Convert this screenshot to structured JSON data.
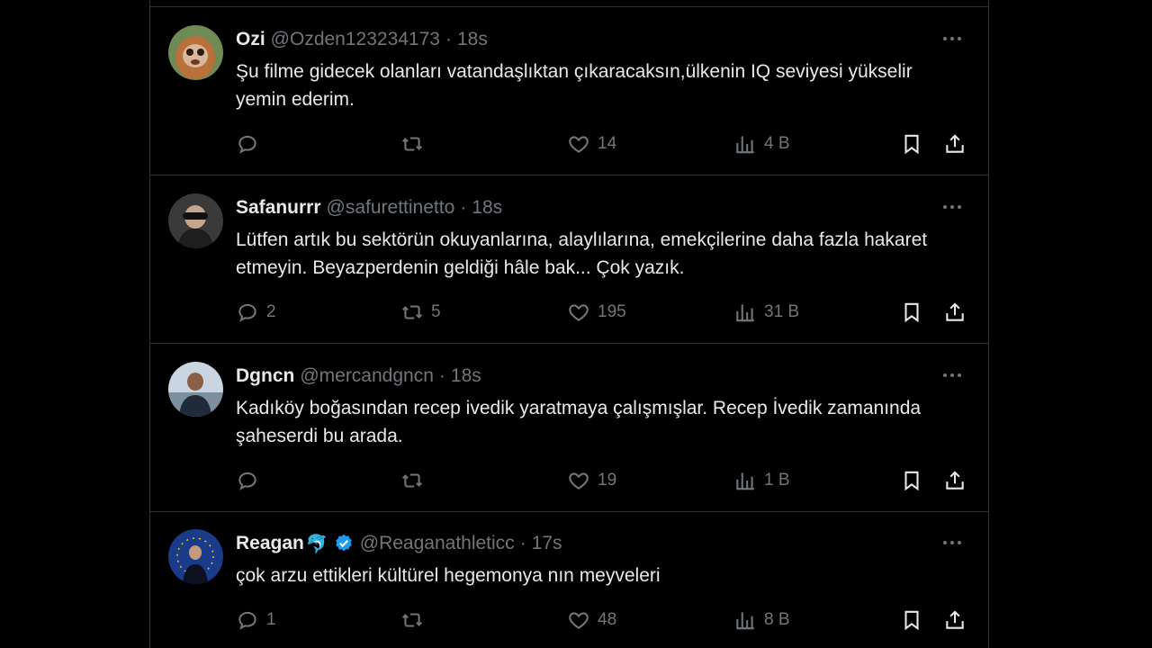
{
  "tweets": [
    {
      "name": "Ozi",
      "handle": "@Ozden123234173",
      "time": "18s",
      "text": "Şu filme gidecek olanları vatandaşlıktan çıkaracaksın,ülkenin IQ seviyesi yükselir yemin ederim.",
      "replies": "",
      "retweets": "",
      "likes": "14",
      "views": "4 B",
      "avatar_color": "#b9703a"
    },
    {
      "name": "Safanurrr",
      "handle": "@safurettinetto",
      "time": "18s",
      "text": "Lütfen artık bu sektörün okuyanlarına, alaylılarına, emekçilerine daha fazla hakaret etmeyin. Beyazperdenin geldiği hâle bak... Çok yazık.",
      "replies": "2",
      "retweets": "5",
      "likes": "195",
      "views": "31 B",
      "avatar_color": "#4a4a4a"
    },
    {
      "name": "Dgncn",
      "handle": "@mercandgncn",
      "time": "18s",
      "text": "Kadıköy boğasından recep ivedik yaratmaya çalışmışlar. Recep İvedik zamanında şaheserdi bu arada.",
      "replies": "",
      "retweets": "",
      "likes": "19",
      "views": "1 B",
      "avatar_color": "#8aa6c0"
    },
    {
      "name": "Reagan",
      "emoji": "🐬",
      "verified": true,
      "handle": "@Reaganathleticc",
      "time": "17s",
      "text": "çok arzu ettikleri kültürel hegemonya nın meyveleri",
      "replies": "1",
      "retweets": "",
      "likes": "48",
      "views": "8 B",
      "avatar_color": "#1a3a8a"
    }
  ],
  "colors": {
    "background": "#000000",
    "border": "#2f3336",
    "text": "#e7e9ea",
    "muted": "#71767b",
    "accent": "#1d9bf0"
  },
  "icons": [
    "reply-icon",
    "retweet-icon",
    "like-icon",
    "views-icon",
    "bookmark-icon",
    "share-icon",
    "more-icon",
    "verified-badge-icon"
  ]
}
